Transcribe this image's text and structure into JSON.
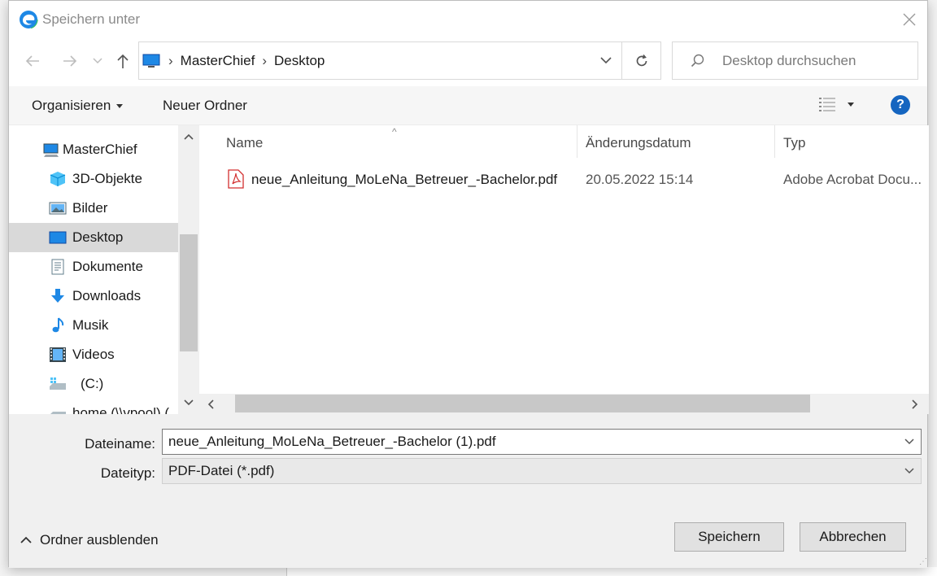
{
  "window": {
    "title": "Speichern unter",
    "close_label": "×"
  },
  "address": {
    "breadcrumbs": [
      "MasterChief",
      "Desktop"
    ],
    "search_placeholder": "Desktop durchsuchen"
  },
  "toolbar": {
    "organize_label": "Organisieren",
    "new_folder_label": "Neuer Ordner",
    "help_label": "?"
  },
  "nav_pane": {
    "items": [
      {
        "label": "MasterChief",
        "icon": "computer-icon"
      },
      {
        "label": "3D-Objekte",
        "icon": "3d-objects-icon"
      },
      {
        "label": "Bilder",
        "icon": "pictures-icon"
      },
      {
        "label": "Desktop",
        "icon": "desktop-icon",
        "selected": true
      },
      {
        "label": "Dokumente",
        "icon": "documents-icon"
      },
      {
        "label": "Downloads",
        "icon": "downloads-icon"
      },
      {
        "label": "Musik",
        "icon": "music-icon"
      },
      {
        "label": "Videos",
        "icon": "videos-icon"
      },
      {
        "label": "(C:)",
        "icon": "drive-icon"
      },
      {
        "label": "home (\\\\vpool) (",
        "icon": "network-drive-icon"
      }
    ]
  },
  "file_list": {
    "columns": [
      "Name",
      "Änderungsdatum",
      "Typ"
    ],
    "rows": [
      {
        "name": "neue_Anleitung_MoLeNa_Betreuer_-Bachelor.pdf",
        "date": "20.05.2022 15:14",
        "type": "Adobe Acrobat Docu...",
        "icon": "pdf-icon"
      }
    ]
  },
  "form": {
    "filename_label": "Dateiname:",
    "filename_value": "neue_Anleitung_MoLeNa_Betreuer_-Bachelor (1).pdf",
    "filetype_label": "Dateityp:",
    "filetype_value": "PDF-Datei (*.pdf)"
  },
  "footer": {
    "hide_folders_label": "Ordner ausblenden",
    "save_label": "Speichern",
    "cancel_label": "Abbrechen"
  },
  "colors": {
    "accent": "#1565c0",
    "selection": "#d9d9d9",
    "pdf_red": "#d32f2f"
  }
}
